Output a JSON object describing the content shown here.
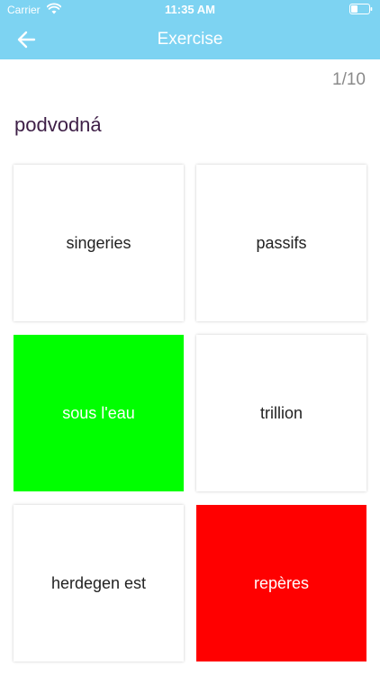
{
  "status_bar": {
    "carrier": "Carrier",
    "time": "11:35 AM"
  },
  "nav": {
    "title": "Exercise",
    "back_icon": "arrow-left-icon"
  },
  "exercise": {
    "progress": "1/10",
    "word": "podvodná",
    "options": [
      {
        "label": "singeries",
        "state": "neutral"
      },
      {
        "label": "passifs",
        "state": "neutral"
      },
      {
        "label": "sous l'eau",
        "state": "correct"
      },
      {
        "label": "trillion",
        "state": "neutral"
      },
      {
        "label": "herdegen est",
        "state": "neutral"
      },
      {
        "label": "repères",
        "state": "wrong"
      }
    ]
  },
  "colors": {
    "header": "#7dd3f2",
    "correct": "#00ff00",
    "wrong": "#ff0000",
    "word": "#3e1f47"
  }
}
